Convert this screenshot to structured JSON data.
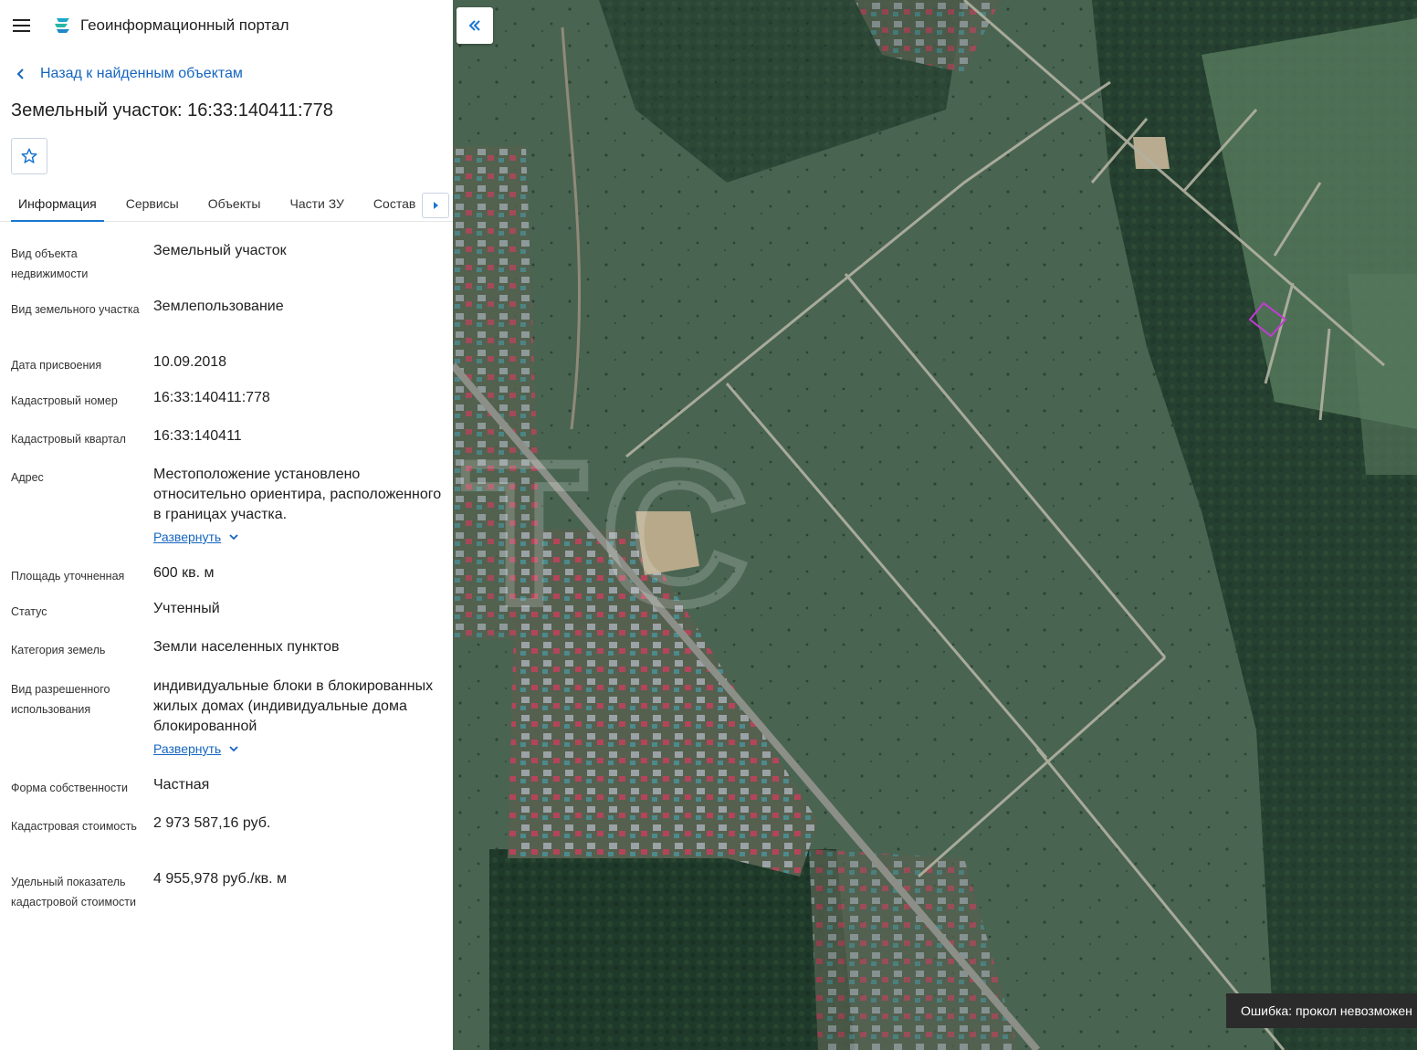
{
  "header": {
    "app_title": "Геоинформационный портал"
  },
  "nav": {
    "back_label": "Назад к найденным объектам"
  },
  "object": {
    "title": "Земельный участок: 16:33:140411:778"
  },
  "tabs": [
    {
      "label": "Информация",
      "active": true
    },
    {
      "label": "Сервисы",
      "active": false
    },
    {
      "label": "Объекты",
      "active": false
    },
    {
      "label": "Части ЗУ",
      "active": false
    },
    {
      "label": "Состав",
      "active": false
    }
  ],
  "properties": [
    {
      "label": "Вид объекта недвижимости",
      "value": "Земельный участок"
    },
    {
      "label": "Вид земельного участка",
      "value": "Землепользование"
    },
    {
      "label": "Дата присвоения",
      "value": "10.09.2018"
    },
    {
      "label": "Кадастровый номер",
      "value": "16:33:140411:778"
    },
    {
      "label": "Кадастровый квартал",
      "value": "16:33:140411"
    },
    {
      "label": "Адрес",
      "value": "Местоположение установлено относительно ориентира, расположенного в границах участка.",
      "expand": "Развернуть"
    },
    {
      "label": "Площадь уточненная",
      "value": "600 кв. м"
    },
    {
      "label": "Статус",
      "value": "Учтенный"
    },
    {
      "label": "Категория земель",
      "value": "Земли населенных пунктов"
    },
    {
      "label": "Вид разрешенного использования",
      "value": "индивидуальные блоки в блокированных жилых домах (индивидуальные дома блокированной",
      "expand": "Развернуть"
    },
    {
      "label": "Форма собственности",
      "value": "Частная"
    },
    {
      "label": "Кадастровая стоимость",
      "value": "2 973 587,16 руб."
    },
    {
      "label": "Удельный показатель кадастровой стоимости",
      "value": "4 955,978 руб./кв. м"
    }
  ],
  "map": {
    "watermark": "МТС",
    "toast": "Ошибка: прокол невозможен"
  },
  "colors": {
    "accent": "#1976d2",
    "link": "#1565c0",
    "parcel": "#c23bd4",
    "toast_bg": "#2b2b2b"
  }
}
